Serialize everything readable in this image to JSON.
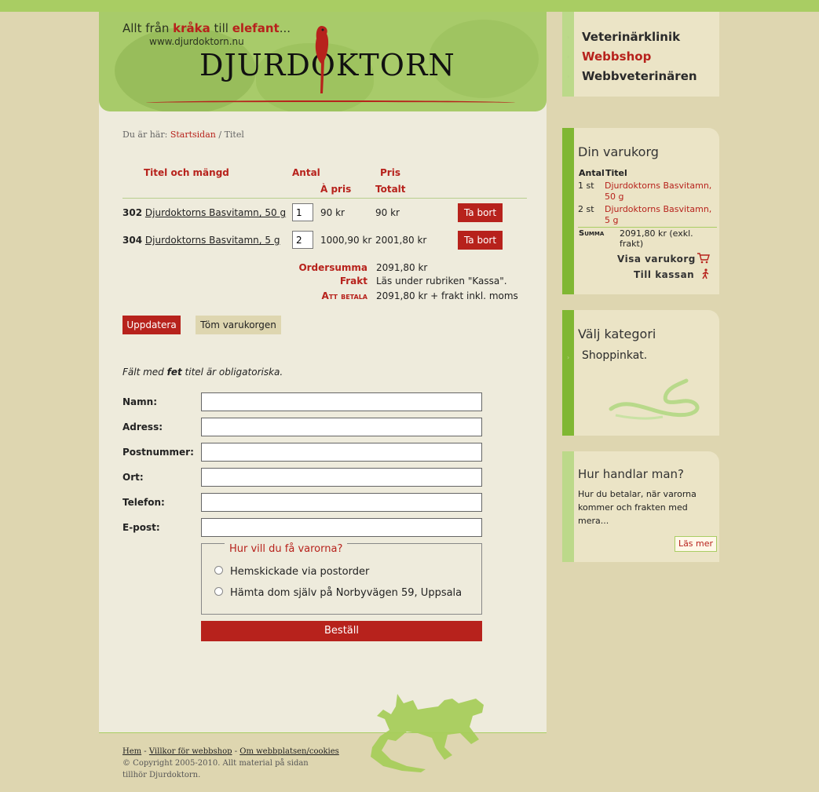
{
  "header": {
    "tagline_parts": [
      "Allt från ",
      "kråka",
      " till ",
      "elefant",
      "..."
    ],
    "site_url": "www.djurdoktorn.nu",
    "logo_text": "DJURDOKTORN"
  },
  "breadcrumb": {
    "prefix": "Du är här: ",
    "home": "Startsidan",
    "separator": " / ",
    "current": "Titel"
  },
  "cart_table": {
    "headers": {
      "title": "Titel och mängd",
      "qty": "Antal",
      "price": "Pris",
      "unit_price": "À pris",
      "total": "Totalt"
    },
    "rows": [
      {
        "num": "302",
        "name": "Djurdoktorns Basvitamn, 50 g",
        "qty": "1",
        "unit": "90 kr",
        "total": "90 kr",
        "remove": "Ta bort"
      },
      {
        "num": "304",
        "name": "Djurdoktorns Basvitamn, 5 g",
        "qty": "2",
        "unit": "1000,90 kr",
        "total": "2001,80 kr",
        "remove": "Ta bort"
      }
    ],
    "summary": {
      "order_sum_label": "Ordersumma",
      "order_sum_value": "2091,80 kr",
      "shipping_label": "Frakt",
      "shipping_value": "Läs under rubriken \"Kassa\".",
      "to_pay_label": "Att betala",
      "to_pay_value": "2091,80 kr + frakt inkl. moms"
    },
    "update_button": "Uppdatera",
    "empty_button": "Töm varukorgen"
  },
  "form": {
    "note_parts": [
      "Fält med ",
      "fet",
      " titel är obligatoriska."
    ],
    "fields": [
      "Namn:",
      "Adress:",
      "Postnummer:",
      "Ort:",
      "Telefon:",
      "E-post:"
    ],
    "delivery_legend": "Hur vill du få varorna?",
    "delivery_options": [
      "Hemskickade via postorder",
      "Hämta dom själv på Norbyvägen 59, Uppsala"
    ],
    "submit": "Beställ"
  },
  "footer": {
    "links": [
      "Hem",
      "Villkor för webbshop",
      "Om webbplatsen/cookies"
    ],
    "separator": " - ",
    "copyright": "© Copyright 2005-2010. Allt material på sidan tillhör Djurdoktorn."
  },
  "sidebar": {
    "nav": [
      {
        "label": "Veterinärklinik",
        "active": false
      },
      {
        "label": "Webbshop",
        "active": true
      },
      {
        "label": "Webbveterinären",
        "active": false
      }
    ],
    "cart": {
      "title": "Din varukorg",
      "col_qty": "Antal",
      "col_title": "Titel",
      "items": [
        {
          "qty": "1 st",
          "name": "Djurdoktorns Basvitamn, 50 g"
        },
        {
          "qty": "2 st",
          "name": "Djurdoktorns Basvitamn, 5 g"
        }
      ],
      "sum_label": "Summa",
      "sum_value": "2091,80 kr (exkl. frakt)",
      "view_cart": "Visa varukorg",
      "checkout": "Till kassan"
    },
    "category": {
      "title": "Välj kategori",
      "item": "Shoppinkat."
    },
    "howto": {
      "title": "Hur handlar man?",
      "text": "Hur du betalar, när varorna kommer och frakten med mera...",
      "more": "Läs mer"
    }
  },
  "colors": {
    "accent_red": "#b7221c",
    "green": "#a9cd63",
    "beige": "#ded6b0",
    "paper": "#eeebdc"
  }
}
